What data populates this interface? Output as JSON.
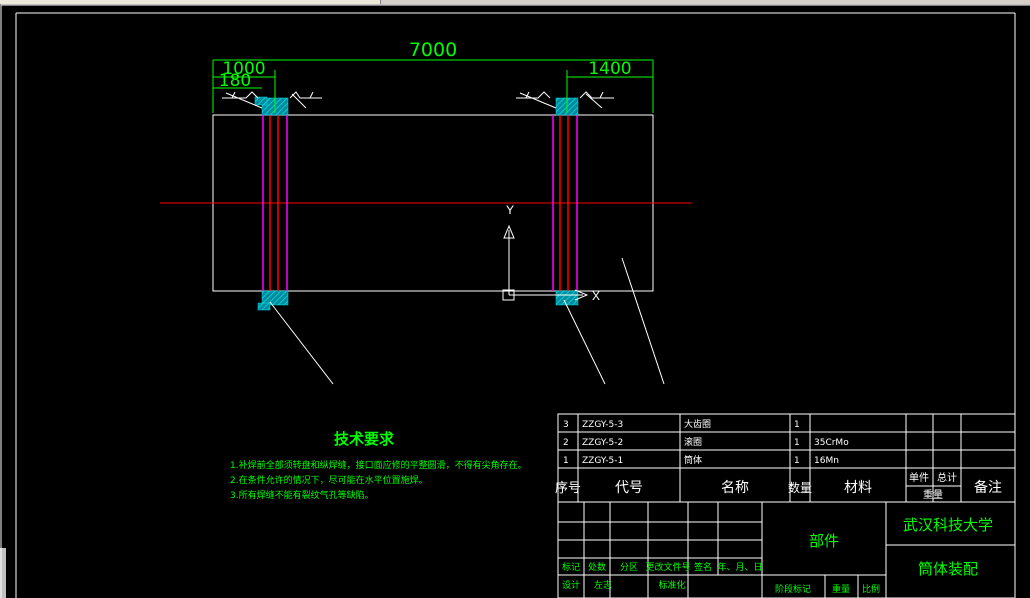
{
  "window": {
    "title": ""
  },
  "dimensions": {
    "overall": "7000",
    "left_offset": "1000",
    "left_small": "180",
    "right_offset": "1400"
  },
  "axis": {
    "y_label": "Y",
    "x_label": "X"
  },
  "tech_requirements": {
    "title": "技术要求",
    "items": [
      "1.补焊前全部须转盘和纵焊缝，接口面应修的平整圆滑，不得有尖角存在。",
      "2.在条件允许的情况下，尽可能在水平位置施焊。",
      "3.所有焊缝不能有裂纹气孔等缺陷。"
    ]
  },
  "parts_list": {
    "rows": [
      {
        "no": "3",
        "code": "ZZGY-5-3",
        "name": "大齿圈",
        "qty": "1",
        "material": ""
      },
      {
        "no": "2",
        "code": "ZZGY-5-2",
        "name": "滚圈",
        "qty": "1",
        "material": "35CrMo"
      },
      {
        "no": "1",
        "code": "ZZGY-5-1",
        "name": "筒体",
        "qty": "1",
        "material": "16Mn"
      }
    ],
    "headers": {
      "no": "序号",
      "code": "代号",
      "name": "名称",
      "qty": "数量",
      "material": "材料",
      "unit": "单件",
      "total": "总计",
      "weight": "重量",
      "remark": "备注"
    }
  },
  "title_block": {
    "part_type": "部件",
    "org": "武汉科技大学",
    "drawing_name": "筒体装配",
    "row_labels": [
      "标记",
      "处数",
      "分区",
      "更改文件号",
      "签名",
      "年、月、日"
    ],
    "sign_labels": [
      "设计",
      "左志",
      "",
      "标准化"
    ],
    "stage_labels": [
      "阶段标记",
      "重量",
      "比例"
    ]
  },
  "colors": {
    "outline": "#ffffff",
    "dimension": "#00ff00",
    "centerline": "#ff0000",
    "ring": "#ff00ff",
    "hatch": "#00b0c0",
    "text": "#00ff00"
  }
}
